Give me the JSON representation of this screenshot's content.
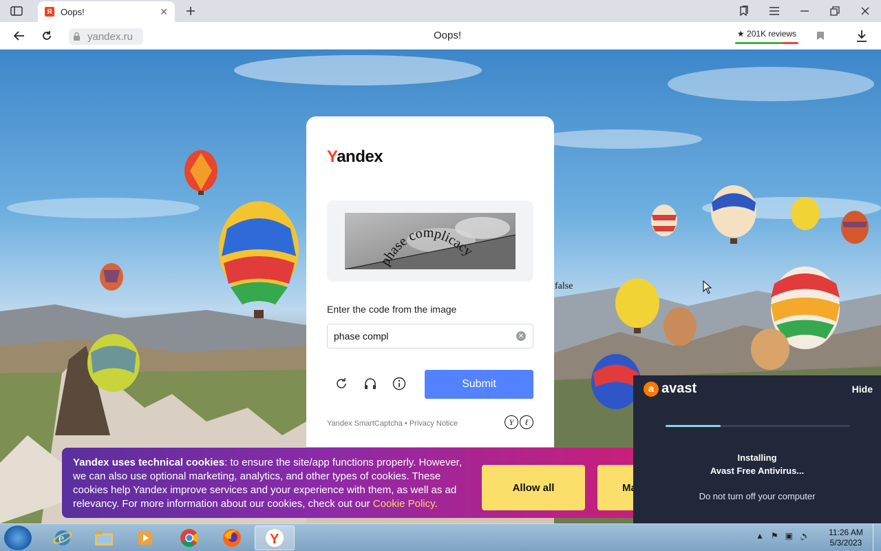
{
  "browser": {
    "tab_title": "Oops!",
    "favicon_letter": "Я",
    "url": "yandex.ru",
    "page_title": "Oops!",
    "reviews": "★ 201K reviews"
  },
  "captcha": {
    "logo_first": "Y",
    "logo_rest": "andex",
    "captcha_text": "phase complicacy",
    "label": "Enter the code from the image",
    "input_value": "phase compl",
    "submit_label": "Submit",
    "footer": "Yandex SmartCaptcha • Privacy Notice"
  },
  "stray_text": "false",
  "cookie": {
    "bold": "Yandex uses technical cookies",
    "text": ": to ensure the site/app functions properly. However, we can also use optional marketing, analytics, and other types of cookies. These cookies help Yandex improve services and your experience with them, as well as ad relevancy. For more information about our cookies, check out our ",
    "link": "Cookie Policy",
    "end": ".",
    "allow_label": "Allow all",
    "manage_label": "Ma"
  },
  "avast": {
    "brand": "avast",
    "hide_label": "Hide",
    "progress": 0.3,
    "line1": "Installing",
    "line2": "Avast Free Antivirus...",
    "warning": "Do not turn off your computer"
  },
  "taskbar": {
    "time": "11:26 AM",
    "date": "5/3/2023"
  },
  "colors": {
    "yandex_red": "#fc3f1d",
    "submit_blue": "#5282ff",
    "cookie_button": "#fcdf6b",
    "avast_orange": "#ff7800"
  }
}
